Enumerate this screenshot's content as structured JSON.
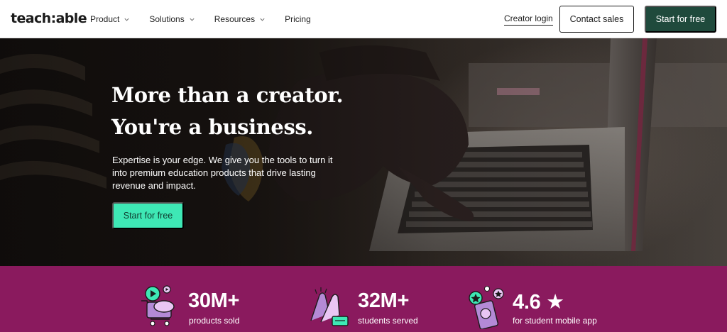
{
  "brand": {
    "logo_text": "teach:able"
  },
  "nav": {
    "items": [
      {
        "label": "Product",
        "has_dropdown": true
      },
      {
        "label": "Solutions",
        "has_dropdown": true
      },
      {
        "label": "Resources",
        "has_dropdown": true
      },
      {
        "label": "Pricing",
        "has_dropdown": false
      }
    ],
    "creator_login": "Creator login",
    "contact_sales": "Contact sales",
    "start_for_free": "Start for free"
  },
  "hero": {
    "title_line1": "More than a creator.",
    "title_line2": "You're a business.",
    "subtitle": "Expertise is your edge. We give you the tools to turn it into premium education products that drive lasting revenue and impact.",
    "cta": "Start for free"
  },
  "stats": [
    {
      "value": "30M+",
      "label": "products sold",
      "icon": "shopping-cart-icon"
    },
    {
      "value": "32M+",
      "label": "students served",
      "icon": "high-five-icon"
    },
    {
      "value": "4.6 ★",
      "label": "for student mobile app",
      "icon": "mobile-app-icon"
    }
  ],
  "colors": {
    "nav_cta_bg": "#1f4a3c",
    "hero_cta_bg": "#3ee8b5",
    "stats_band_bg": "#8a1a5e"
  }
}
